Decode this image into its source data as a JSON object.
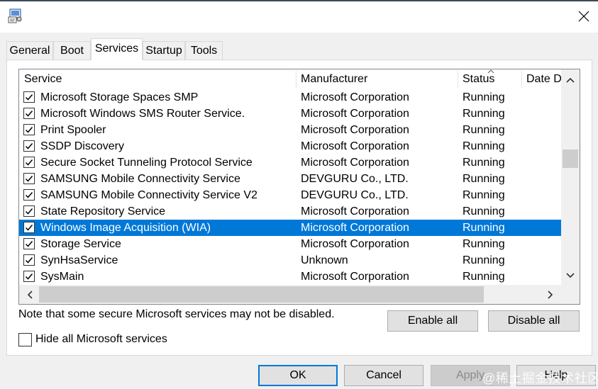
{
  "tabs": [
    {
      "label": "General"
    },
    {
      "label": "Boot"
    },
    {
      "label": "Services",
      "active": true
    },
    {
      "label": "Startup"
    },
    {
      "label": "Tools"
    }
  ],
  "columns": {
    "service": "Service",
    "manufacturer": "Manufacturer",
    "status": "Status",
    "date": "Date D"
  },
  "services": [
    {
      "name": "Microsoft Storage Spaces SMP",
      "manufacturer": "Microsoft Corporation",
      "status": "Running",
      "checked": true
    },
    {
      "name": "Microsoft Windows SMS Router Service.",
      "manufacturer": "Microsoft Corporation",
      "status": "Running",
      "checked": true
    },
    {
      "name": "Print Spooler",
      "manufacturer": "Microsoft Corporation",
      "status": "Running",
      "checked": true
    },
    {
      "name": "SSDP Discovery",
      "manufacturer": "Microsoft Corporation",
      "status": "Running",
      "checked": true
    },
    {
      "name": "Secure Socket Tunneling Protocol Service",
      "manufacturer": "Microsoft Corporation",
      "status": "Running",
      "checked": true
    },
    {
      "name": "SAMSUNG Mobile Connectivity Service",
      "manufacturer": "DEVGURU Co., LTD.",
      "status": "Running",
      "checked": true
    },
    {
      "name": "SAMSUNG Mobile Connectivity Service V2",
      "manufacturer": "DEVGURU Co., LTD.",
      "status": "Running",
      "checked": true
    },
    {
      "name": "State Repository Service",
      "manufacturer": "Microsoft Corporation",
      "status": "Running",
      "checked": true
    },
    {
      "name": "Windows Image Acquisition (WIA)",
      "manufacturer": "Microsoft Corporation",
      "status": "Running",
      "checked": true,
      "selected": true
    },
    {
      "name": "Storage Service",
      "manufacturer": "Microsoft Corporation",
      "status": "Running",
      "checked": true
    },
    {
      "name": "SynHsaService",
      "manufacturer": "Unknown",
      "status": "Running",
      "checked": true
    },
    {
      "name": "SysMain",
      "manufacturer": "Microsoft Corporation",
      "status": "Running",
      "checked": true
    }
  ],
  "note": "Note that some secure Microsoft services may not be disabled.",
  "buttons": {
    "enable_all": "Enable all",
    "disable_all": "Disable all",
    "ok": "OK",
    "cancel": "Cancel",
    "apply": "Apply",
    "help": "Help"
  },
  "hide_ms_label": "Hide all Microsoft services",
  "hide_ms_checked": false,
  "watermark": "@稀土掘金技术社区",
  "colors": {
    "selection": "#0078d7",
    "default_button_border": "#0078d7",
    "panel": "#ffffff",
    "dialog": "#f0f0f0"
  },
  "icons": {
    "app": "msconfig-icon",
    "close": "close-icon",
    "check": "checkmark-icon",
    "sort": "sort-up-icon",
    "scroll_up": "chevron-up-icon",
    "scroll_down": "chevron-down-icon",
    "scroll_left": "chevron-left-icon",
    "scroll_right": "chevron-right-icon"
  }
}
